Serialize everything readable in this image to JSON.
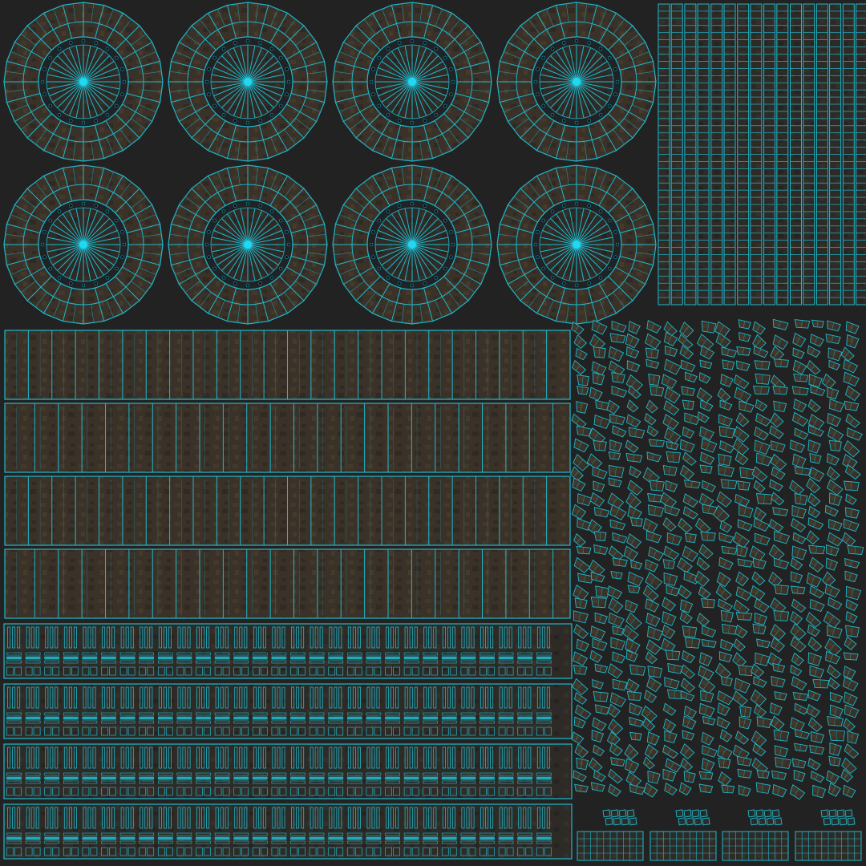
{
  "uv_layout": {
    "background_color": "#222222",
    "wire_color": "#1fb8cc",
    "hub_color": "#22d8f0",
    "texture_color": "#3b3328",
    "wheels": {
      "rows": 2,
      "columns": 4,
      "radial_segments": 24,
      "spoke_count": 32
    },
    "rim_strips": {
      "count": 16,
      "rows_per_strip": 42
    },
    "tread_bands": {
      "count": 4,
      "columns": 24
    },
    "circuit_bands": {
      "count": 4
    },
    "lug_scatter": {
      "columns": 4
    },
    "bottom_right_blocks": {
      "count": 4
    }
  }
}
